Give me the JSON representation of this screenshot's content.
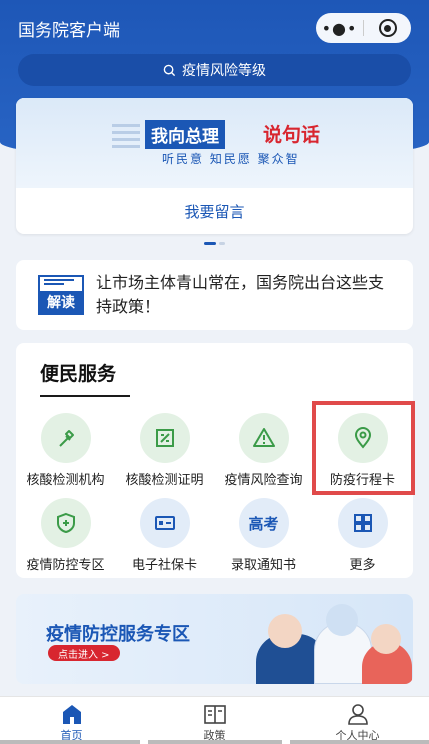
{
  "app": {
    "title": "国务院客户端"
  },
  "search": {
    "placeholder": "疫情风险等级"
  },
  "banner": {
    "tag": "我向总理",
    "highlight": "说句话",
    "subtitle": "听民意 知民愿 聚众智",
    "action_label": "我要留言"
  },
  "news": {
    "badge_label": "解读",
    "text": "让市场主体青山常在，国务院出台这些支持政策！"
  },
  "services": {
    "title": "便民服务",
    "items": [
      {
        "label": "核酸检测机构",
        "icon": "dropper-icon",
        "color": "green"
      },
      {
        "label": "核酸检测证明",
        "icon": "certificate-icon",
        "color": "green"
      },
      {
        "label": "疫情风险查询",
        "icon": "warning-icon",
        "color": "green"
      },
      {
        "label": "防疫行程卡",
        "icon": "location-pin-icon",
        "color": "green"
      },
      {
        "label": "疫情防控专区",
        "icon": "shield-plus-icon",
        "color": "green"
      },
      {
        "label": "电子社保卡",
        "icon": "id-card-icon",
        "color": "blue"
      },
      {
        "label": "录取通知书",
        "icon": "gaokao-icon",
        "icon_text": "高考",
        "color": "blue"
      },
      {
        "label": "更多",
        "icon": "grid-icon",
        "color": "blue"
      }
    ]
  },
  "promo": {
    "title": "疫情防控服务专区",
    "button_label": "点击进入 >"
  },
  "tabbar": {
    "tabs": [
      {
        "label": "首页",
        "icon": "home-icon",
        "active": true
      },
      {
        "label": "政策",
        "icon": "book-icon",
        "active": false
      },
      {
        "label": "个人中心",
        "icon": "user-icon",
        "active": false
      }
    ]
  },
  "colors": {
    "primary": "#1b57b5",
    "header": "#2864c4",
    "accent_red": "#d8262f",
    "green": "#3b9b48"
  }
}
